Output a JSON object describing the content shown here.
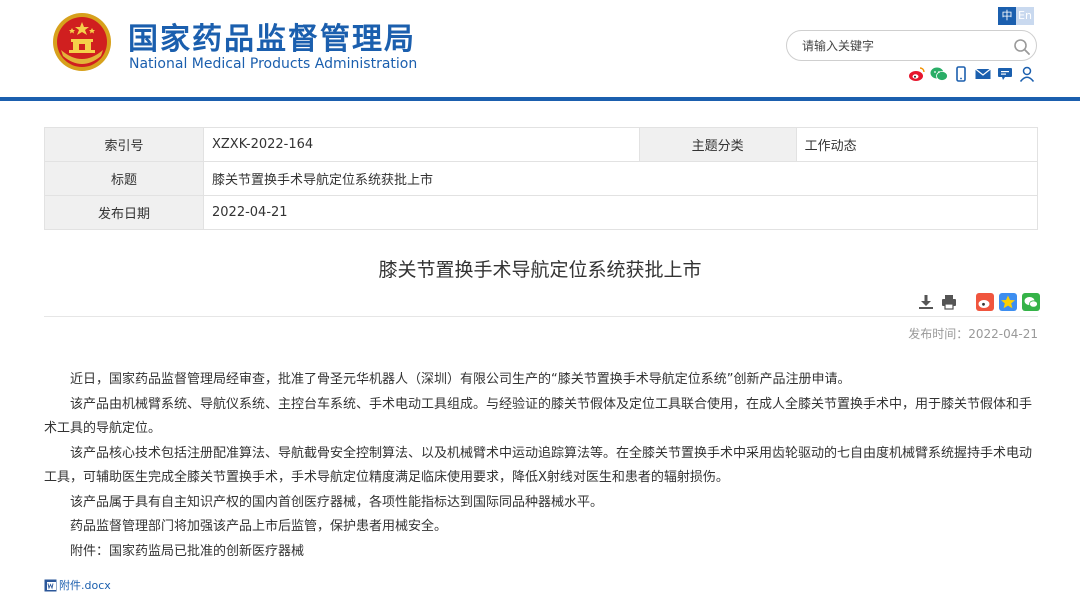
{
  "header": {
    "cn_title": "国家药品监督管理局",
    "en_title": "National Medical Products Administration",
    "lang": {
      "zh": "中",
      "en": "En"
    },
    "search": {
      "placeholder": "请输入关键字"
    },
    "social_icons": [
      "weibo-icon",
      "wechat-icon",
      "mobile-icon",
      "mail-icon",
      "message-board-icon",
      "user-icon"
    ],
    "brand_color": "#1b5fae"
  },
  "info": {
    "index_label": "索引号",
    "index_value": "XZXK-2022-164",
    "category_label": "主题分类",
    "category_value": "工作动态",
    "title_label": "标题",
    "title_value": "膝关节置换手术导航定位系统获批上市",
    "date_label": "发布日期",
    "date_value": "2022-04-21"
  },
  "article": {
    "title": "膝关节置换手术导航定位系统获批上市",
    "tool_icons": [
      "download-icon",
      "print-icon",
      "weibo-share-icon",
      "qzone-share-icon",
      "wechat-share-icon"
    ],
    "publish_time": "发布时间：2022-04-21",
    "paragraphs": [
      "近日，国家药品监督管理局经审查，批准了骨圣元华机器人（深圳）有限公司生产的“膝关节置换手术导航定位系统”创新产品注册申请。",
      "该产品由机械臂系统、导航仪系统、主控台车系统、手术电动工具组成。与经验证的膝关节假体及定位工具联合使用，在成人全膝关节置换手术中，用于膝关节假体和手术工具的导航定位。",
      "该产品核心技术包括注册配准算法、导航截骨安全控制算法、以及机械臂术中运动追踪算法等。在全膝关节置换手术中采用齿轮驱动的七自由度机械臂系统握持手术电动工具，可辅助医生完成全膝关节置换手术，手术导航定位精度满足临床使用要求，降低X射线对医生和患者的辐射损伤。",
      "该产品属于具有自主知识产权的国内首创医疗器械，各项性能指标达到国际同品种器械水平。",
      "药品监督管理部门将加强该产品上市后监管，保护患者用械安全。",
      "附件：国家药监局已批准的创新医疗器械"
    ],
    "attachment": "附件.docx"
  }
}
